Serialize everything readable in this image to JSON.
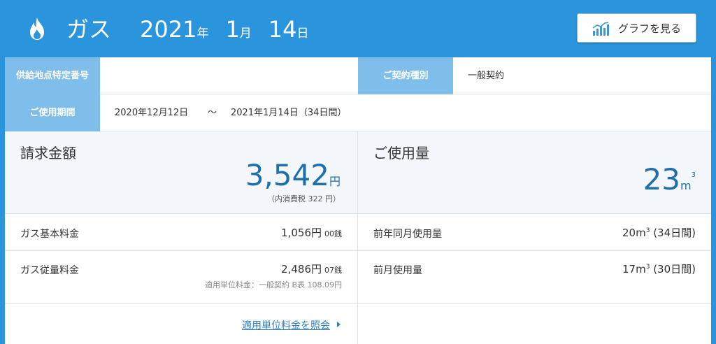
{
  "header": {
    "title": "ガス",
    "date": {
      "year": "2021",
      "year_unit": "年",
      "month": "1",
      "month_unit": "月",
      "day": "14",
      "day_unit": "日"
    },
    "graph_button": "グラフを見る",
    "icons": {
      "flame": "flame-icon",
      "graph": "bar-chart-icon"
    }
  },
  "contract": {
    "supply_point_label": "供給地点特定番号",
    "supply_point_value": "",
    "contract_type_label": "ご契約種別",
    "contract_type_value": "一般契約",
    "period_label": "ご使用期間",
    "period_start": "2020年12月12日",
    "period_sep": "～",
    "period_end": "2021年1月14日（34日間）"
  },
  "billing": {
    "title": "請求金額",
    "amount": "3,542",
    "unit": "円",
    "tax_note": "（内消費税 322 円）",
    "items": [
      {
        "label": "ガス基本料金",
        "value": "1,056円",
        "sen": "00銭"
      },
      {
        "label": "ガス従量料金",
        "value": "2,486円",
        "sen": "07銭",
        "note": "適用単位料金：一般契約 B表 108.09円"
      }
    ],
    "link": "適用単位料金を照会"
  },
  "usage": {
    "title": "ご使用量",
    "amount": "23",
    "unit": "m",
    "unit_sup": "3",
    "items": [
      {
        "label": "前年同月使用量",
        "value": "20m",
        "sup": "3",
        "days": " (34日間)"
      },
      {
        "label": "前月使用量",
        "value": "17m",
        "sup": "3",
        "days": " (30日間)"
      }
    ]
  },
  "colors": {
    "header_bg": "#2a95dc",
    "label_bg": "#7fbdea",
    "accent": "#1f6fad",
    "link": "#2a7fc0"
  }
}
